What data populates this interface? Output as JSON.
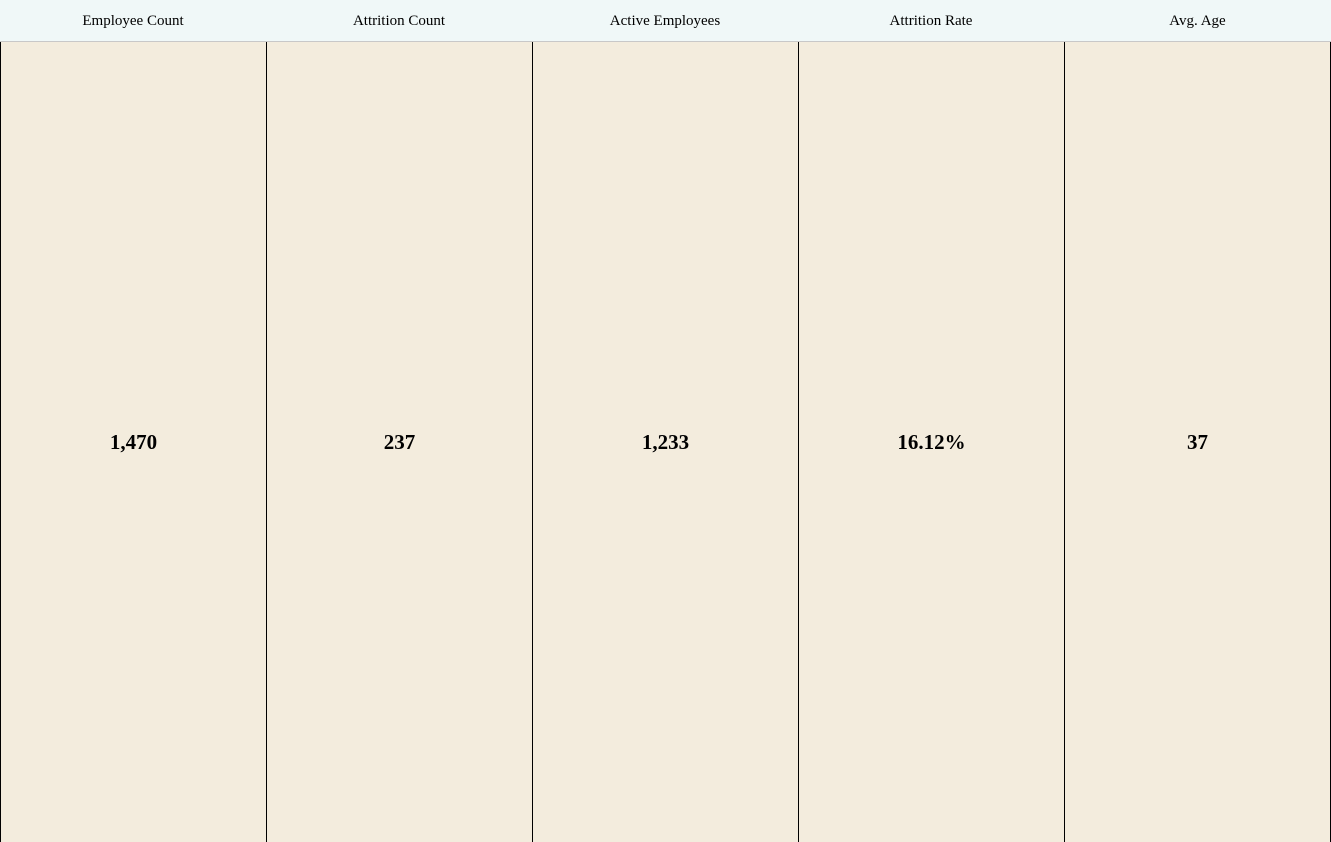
{
  "kpis": [
    {
      "label": "Employee Count",
      "value": "1,470"
    },
    {
      "label": "Attrition Count",
      "value": "237"
    },
    {
      "label": "Active Employees",
      "value": "1,233"
    },
    {
      "label": "Attrition Rate",
      "value": "16.12%"
    },
    {
      "label": "Avg. Age",
      "value": "37"
    }
  ],
  "colors": {
    "header_background": "#f0f8f8",
    "cell_background": "#f3ecdd",
    "border": "#000000",
    "text": "#000000"
  }
}
